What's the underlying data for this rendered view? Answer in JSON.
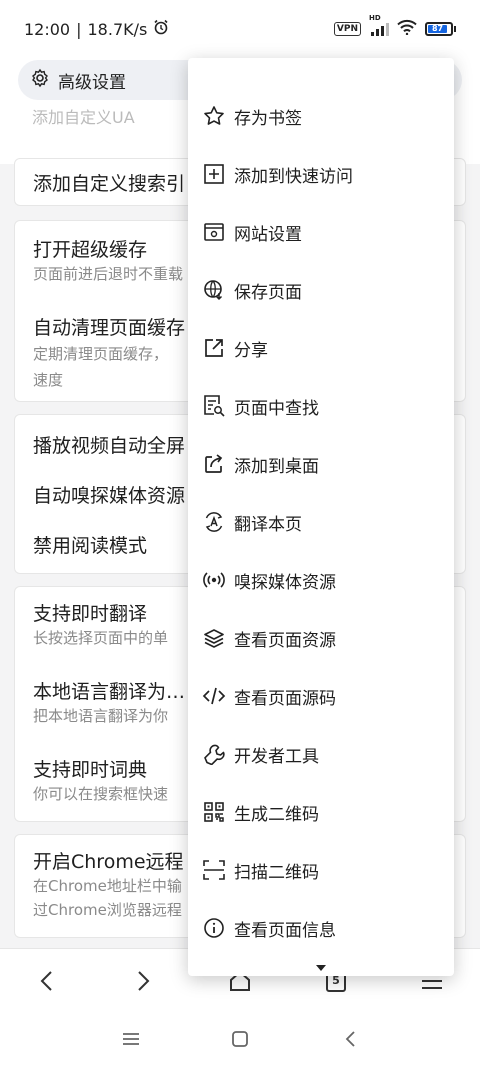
{
  "status_bar": {
    "time": "12:00",
    "speed": "18.7K/s",
    "vpn": "VPN",
    "network": "HD",
    "battery": "87"
  },
  "header": {
    "title": "高级设置",
    "peek_text": "添加自定义UA"
  },
  "cards": [
    {
      "title": "添加自定义搜索引"
    },
    {
      "title": "打开超级缓存",
      "desc": "页面前进后退时不重载"
    },
    {
      "title": "自动清理页面缓存",
      "desc1": "定期清理页面缓存，",
      "desc2": "速度"
    },
    {
      "title": "播放视频自动全屏"
    },
    {
      "title": "自动嗅探媒体资源"
    },
    {
      "title": "禁用阅读模式"
    },
    {
      "title": "支持即时翻译",
      "desc": "长按选择页面中的单"
    },
    {
      "title": "本地语言翻译为…",
      "desc": "把本地语言翻译为你"
    },
    {
      "title": "支持即时词典",
      "desc": "你可以在搜索框快速"
    },
    {
      "title": "开启Chrome远程",
      "desc1": "在Chrome地址栏中输",
      "desc2": "过Chrome浏览器远程"
    }
  ],
  "menu": {
    "items": [
      {
        "label": "存为书签",
        "icon": "star-icon"
      },
      {
        "label": "添加到快速访问",
        "icon": "add-box-icon"
      },
      {
        "label": "网站设置",
        "icon": "site-settings-icon"
      },
      {
        "label": "保存页面",
        "icon": "globe-download-icon"
      },
      {
        "label": "分享",
        "icon": "share-icon"
      },
      {
        "label": "页面中查找",
        "icon": "find-in-page-icon"
      },
      {
        "label": "添加到桌面",
        "icon": "add-to-desktop-icon"
      },
      {
        "label": "翻译本页",
        "icon": "translate-icon"
      },
      {
        "label": "嗅探媒体资源",
        "icon": "sniff-media-icon"
      },
      {
        "label": "查看页面资源",
        "icon": "layers-icon"
      },
      {
        "label": "查看页面源码",
        "icon": "code-icon"
      },
      {
        "label": "开发者工具",
        "icon": "wrench-icon"
      },
      {
        "label": "生成二维码",
        "icon": "qr-code-icon"
      },
      {
        "label": "扫描二维码",
        "icon": "scan-icon"
      },
      {
        "label": "查看页面信息",
        "icon": "info-icon"
      }
    ]
  },
  "toolbar": {
    "tab_count": "5"
  },
  "colors": {
    "background": "#f4f4f5",
    "accent_battery": "#1565e0",
    "text": "#1f1f1f",
    "subtext": "#8a8a8a"
  }
}
